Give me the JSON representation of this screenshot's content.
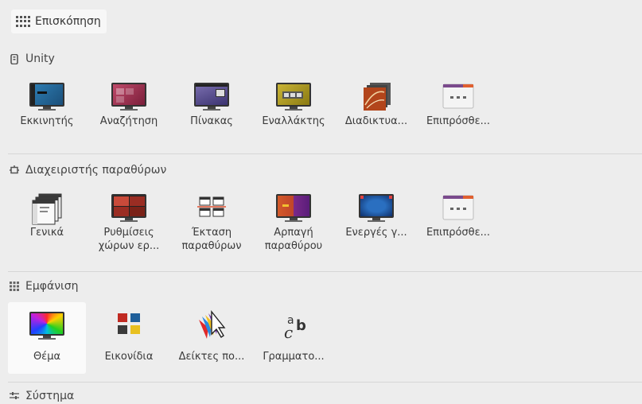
{
  "header": {
    "title": "Επισκόπηση"
  },
  "sections": [
    {
      "title": "Unity",
      "items": [
        {
          "label": "Εκκινητής",
          "icon": "launcher-icon"
        },
        {
          "label": "Αναζήτηση",
          "icon": "search-dash-icon"
        },
        {
          "label": "Πίνακας",
          "icon": "panel-icon"
        },
        {
          "label": "Εναλλάκτης",
          "icon": "switcher-icon"
        },
        {
          "label": "Διαδικτυα...",
          "icon": "web-apps-icon"
        },
        {
          "label": "Επιπρόσθε...",
          "icon": "additional-icon"
        }
      ]
    },
    {
      "title": "Διαχειριστής παραθύρων",
      "items": [
        {
          "label": "Γενικά",
          "icon": "general-icon"
        },
        {
          "label": "Ρυθμίσεις χώρων ερ...",
          "icon": "workspace-settings-icon"
        },
        {
          "label": "Έκταση παραθύρων",
          "icon": "window-spread-icon"
        },
        {
          "label": "Αρπαγή παραθύρου",
          "icon": "window-snapping-icon"
        },
        {
          "label": "Ενεργές γ...",
          "icon": "hotcorners-icon"
        },
        {
          "label": "Επιπρόσθε...",
          "icon": "additional-icon"
        }
      ]
    },
    {
      "title": "Εμφάνιση",
      "items": [
        {
          "label": "Θέμα",
          "icon": "theme-icon"
        },
        {
          "label": "Εικονίδια",
          "icon": "icons-icon"
        },
        {
          "label": "Δείκτες πο...",
          "icon": "cursors-icon"
        },
        {
          "label": "Γραμματο...",
          "icon": "fonts-icon"
        }
      ]
    },
    {
      "title": "Σύστημα"
    }
  ],
  "colors": {
    "background": "#ededed",
    "selected": "#fafafa"
  }
}
